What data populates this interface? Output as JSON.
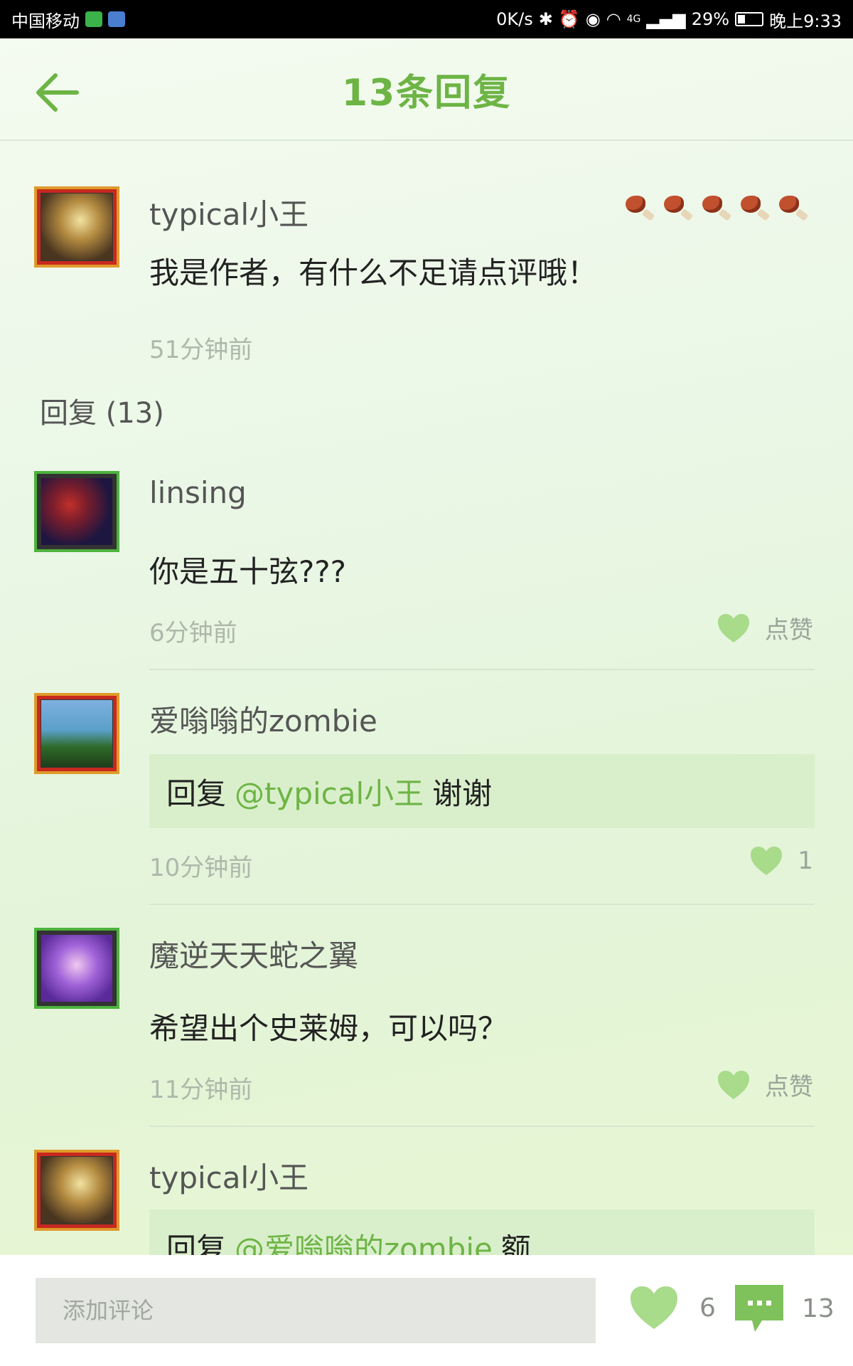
{
  "status_bar": {
    "carrier": "中国移动",
    "speed": "0K/s",
    "signal": "4G",
    "battery": "29%",
    "time": "晚上9:33"
  },
  "header": {
    "title": "13条回复"
  },
  "original_post": {
    "author": "typical小王",
    "text": "我是作者，有什么不足请点评哦！",
    "time": "51分钟前",
    "drumstick_count": 5
  },
  "replies_heading": "回复 (13)",
  "replies": [
    {
      "author": "linsing",
      "text": "你是五十弦???",
      "time": "6分钟前",
      "like_label": "点赞"
    },
    {
      "author": "爱嗡嗡的zombie",
      "quote_prefix": "回复",
      "quote_mention": "@typical小王",
      "quote_text": "谢谢",
      "time": "10分钟前",
      "like_count": "1"
    },
    {
      "author": "魔逆天天蛇之翼",
      "text": "希望出个史莱姆，可以吗？",
      "time": "11分钟前",
      "like_label": "点赞"
    },
    {
      "author": "typical小王",
      "quote_prefix": "回复",
      "quote_mention": "@爱嗡嗡的zombie",
      "quote_text": "额"
    }
  ],
  "bottom_bar": {
    "input_placeholder": "添加评论",
    "likes": "6",
    "comments": "13"
  },
  "colors": {
    "accent": "#6db445",
    "like_heart": "#a8db8a",
    "quote_bg": "#d9efcb"
  }
}
